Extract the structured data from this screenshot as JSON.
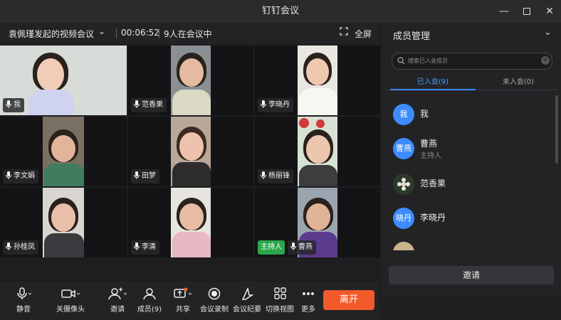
{
  "window": {
    "title": "钉钉会议"
  },
  "meeting": {
    "name": "袁佩瑾发起的视频会议",
    "duration": "00:06:52",
    "count": "9人在会议中",
    "fullscreen": "全屏"
  },
  "tiles": [
    {
      "name": "我"
    },
    {
      "name": "范香果"
    },
    {
      "name": "李晓丹"
    },
    {
      "name": "李文娟"
    },
    {
      "name": "田梦"
    },
    {
      "name": "杨丽锋"
    },
    {
      "name": "孙桂凤"
    },
    {
      "name": "李清"
    },
    {
      "name": "曹燕",
      "host": "主持人"
    }
  ],
  "toolbar": {
    "mute": "静音",
    "camera": "关摄像头",
    "invite": "邀请",
    "members": "成员(9)",
    "share": "共享",
    "record": "会议录制",
    "minutes": "会议纪要",
    "view": "切换视图",
    "more": "更多",
    "leave": "离开"
  },
  "panel": {
    "title": "成员管理",
    "search_placeholder": "搜索已入会成员",
    "tab_joined": "已入会(9)",
    "tab_not_joined": "未入会(0)",
    "members": [
      {
        "avatar": "我",
        "name": "我"
      },
      {
        "avatar": "曹燕",
        "name": "曹燕",
        "role": "主持人"
      },
      {
        "avatar": "",
        "name": "范香果"
      },
      {
        "avatar": "晓丹",
        "name": "李晓丹"
      }
    ],
    "invite": "邀请"
  },
  "colors": {
    "accent": "#3d8bff",
    "leave": "#f25a2c",
    "host": "#2aa74a"
  }
}
